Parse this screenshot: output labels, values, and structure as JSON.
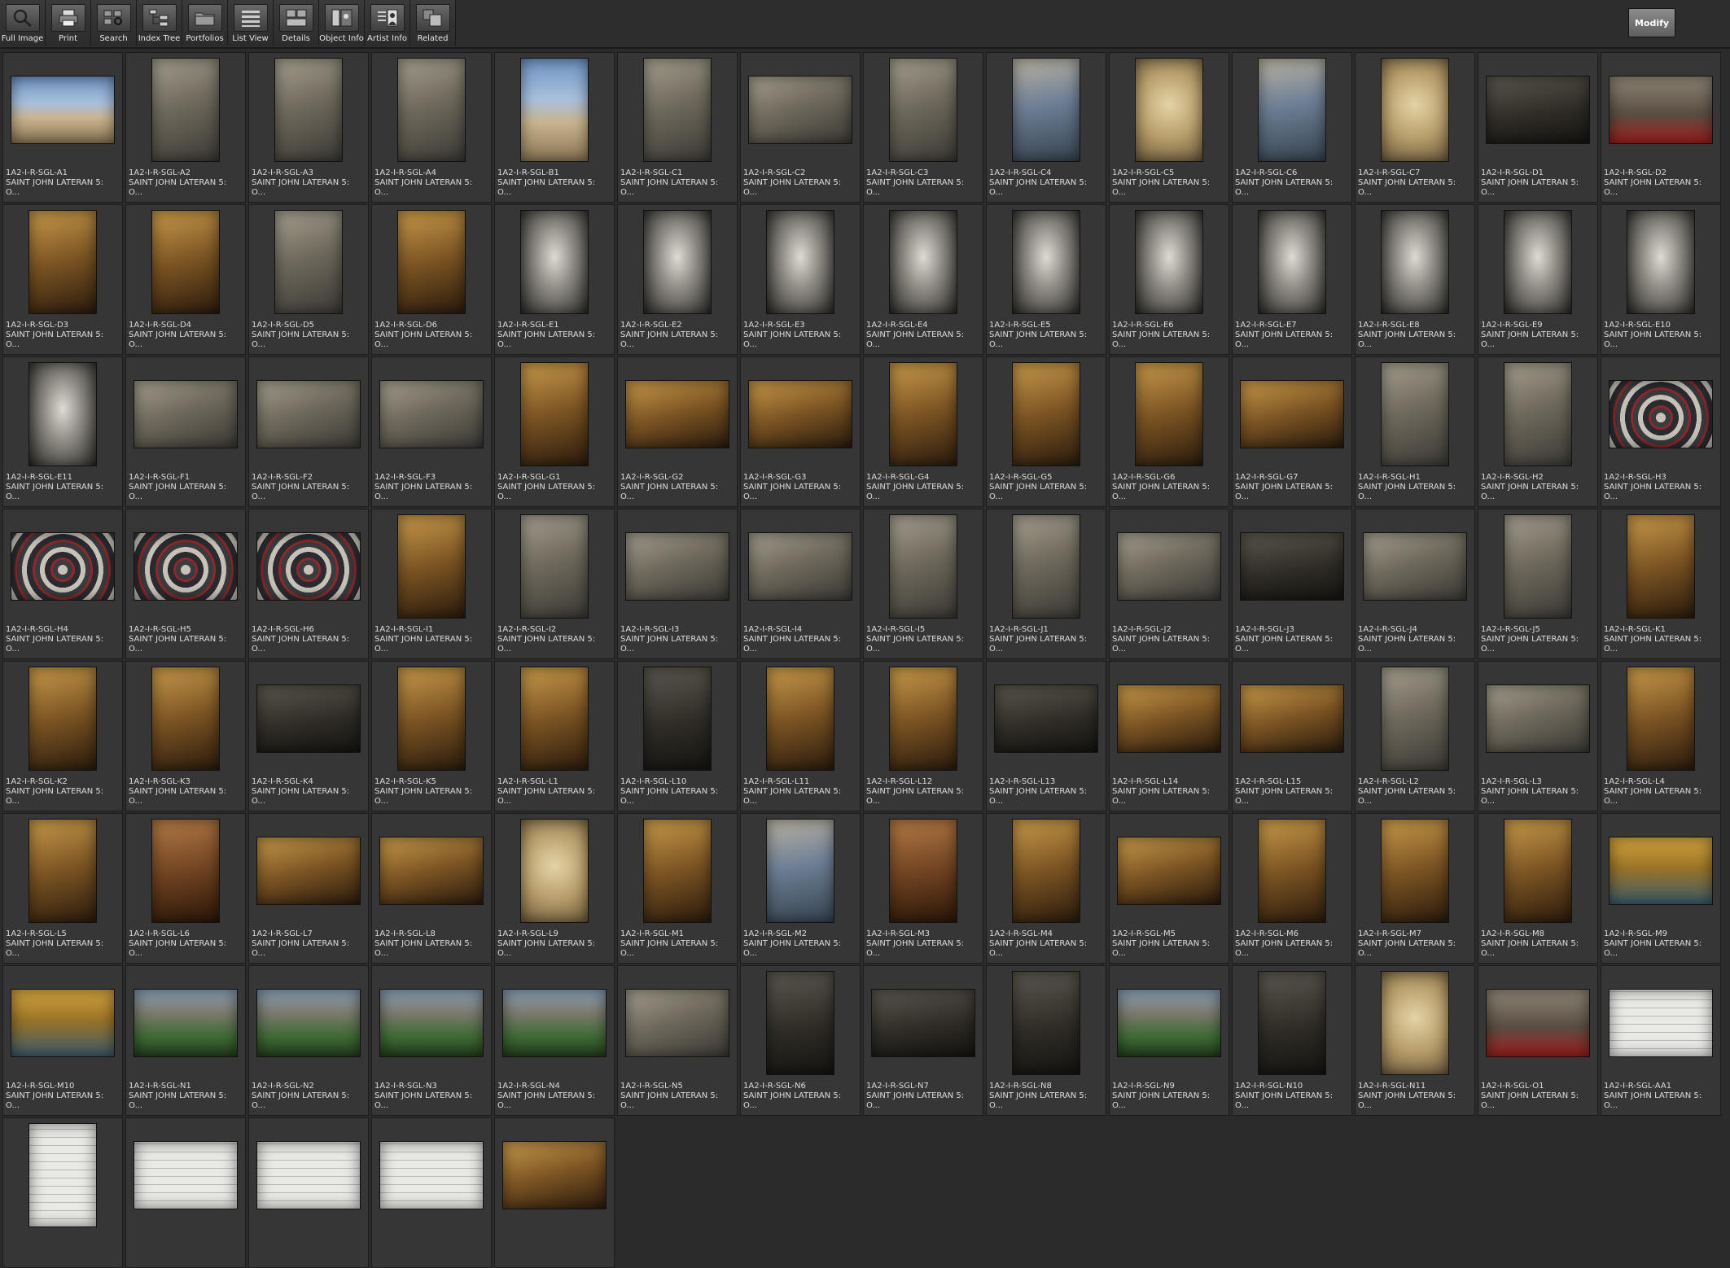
{
  "toolbar": {
    "buttons": [
      {
        "label": "Full Image",
        "icon": "magnifier-icon"
      },
      {
        "label": "Print",
        "icon": "printer-icon"
      },
      {
        "label": "Search",
        "icon": "search-icon"
      },
      {
        "label": "Index Tree",
        "icon": "index-tree-icon"
      },
      {
        "label": "Portfolios",
        "icon": "folder-icon"
      },
      {
        "label": "List View",
        "icon": "list-icon"
      },
      {
        "label": "Details",
        "icon": "details-icon"
      },
      {
        "label": "Object Info",
        "icon": "object-info-icon"
      },
      {
        "label": "Artist  Info",
        "icon": "artist-info-icon"
      },
      {
        "label": "Related",
        "icon": "related-icon"
      }
    ],
    "modify_label": "Modify"
  },
  "grid": {
    "title_text": "SAINT JOHN LATERAN 5:",
    "subtitle_text": "O...",
    "items": [
      {
        "code": "1A2-I-R-SGL-A1",
        "orient": "landscape",
        "tone": "sky"
      },
      {
        "code": "1A2-I-R-SGL-A2",
        "orient": "portrait",
        "tone": "stone"
      },
      {
        "code": "1A2-I-R-SGL-A3",
        "orient": "portrait",
        "tone": "stone"
      },
      {
        "code": "1A2-I-R-SGL-A4",
        "orient": "portrait",
        "tone": "stone"
      },
      {
        "code": "1A2-I-R-SGL-B1",
        "orient": "portrait",
        "tone": "sky"
      },
      {
        "code": "1A2-I-R-SGL-C1",
        "orient": "portrait",
        "tone": "stone"
      },
      {
        "code": "1A2-I-R-SGL-C2",
        "orient": "landscape",
        "tone": "stone"
      },
      {
        "code": "1A2-I-R-SGL-C3",
        "orient": "portrait",
        "tone": "stone"
      },
      {
        "code": "1A2-I-R-SGL-C4",
        "orient": "portrait",
        "tone": "blue"
      },
      {
        "code": "1A2-I-R-SGL-C5",
        "orient": "portrait",
        "tone": "fresco"
      },
      {
        "code": "1A2-I-R-SGL-C6",
        "orient": "portrait",
        "tone": "blue"
      },
      {
        "code": "1A2-I-R-SGL-C7",
        "orient": "portrait",
        "tone": "fresco"
      },
      {
        "code": "1A2-I-R-SGL-D1",
        "orient": "landscape",
        "tone": "dark"
      },
      {
        "code": "1A2-I-R-SGL-D2",
        "orient": "landscape",
        "tone": "red"
      },
      {
        "code": "1A2-I-R-SGL-D3",
        "orient": "portrait",
        "tone": "gold"
      },
      {
        "code": "1A2-I-R-SGL-D4",
        "orient": "portrait",
        "tone": "gold"
      },
      {
        "code": "1A2-I-R-SGL-D5",
        "orient": "portrait",
        "tone": "stone"
      },
      {
        "code": "1A2-I-R-SGL-D6",
        "orient": "portrait",
        "tone": "gold"
      },
      {
        "code": "1A2-I-R-SGL-E1",
        "orient": "portrait",
        "tone": "statue"
      },
      {
        "code": "1A2-I-R-SGL-E2",
        "orient": "portrait",
        "tone": "statue"
      },
      {
        "code": "1A2-I-R-SGL-E3",
        "orient": "portrait",
        "tone": "statue"
      },
      {
        "code": "1A2-I-R-SGL-E4",
        "orient": "portrait",
        "tone": "statue"
      },
      {
        "code": "1A2-I-R-SGL-E5",
        "orient": "portrait",
        "tone": "statue"
      },
      {
        "code": "1A2-I-R-SGL-E6",
        "orient": "portrait",
        "tone": "statue"
      },
      {
        "code": "1A2-I-R-SGL-E7",
        "orient": "portrait",
        "tone": "statue"
      },
      {
        "code": "1A2-I-R-SGL-E8",
        "orient": "portrait",
        "tone": "statue"
      },
      {
        "code": "1A2-I-R-SGL-E9",
        "orient": "portrait",
        "tone": "statue"
      },
      {
        "code": "1A2-I-R-SGL-E10",
        "orient": "portrait",
        "tone": "statue"
      },
      {
        "code": "1A2-I-R-SGL-E11",
        "orient": "portrait",
        "tone": "statue"
      },
      {
        "code": "1A2-I-R-SGL-F1",
        "orient": "landscape",
        "tone": "stone"
      },
      {
        "code": "1A2-I-R-SGL-F2",
        "orient": "landscape",
        "tone": "stone"
      },
      {
        "code": "1A2-I-R-SGL-F3",
        "orient": "landscape",
        "tone": "stone"
      },
      {
        "code": "1A2-I-R-SGL-G1",
        "orient": "portrait",
        "tone": "gold"
      },
      {
        "code": "1A2-I-R-SGL-G2",
        "orient": "landscape",
        "tone": "gold"
      },
      {
        "code": "1A2-I-R-SGL-G3",
        "orient": "landscape",
        "tone": "gold"
      },
      {
        "code": "1A2-I-R-SGL-G4",
        "orient": "portrait",
        "tone": "gold"
      },
      {
        "code": "1A2-I-R-SGL-G5",
        "orient": "portrait",
        "tone": "gold"
      },
      {
        "code": "1A2-I-R-SGL-G6",
        "orient": "portrait",
        "tone": "gold"
      },
      {
        "code": "1A2-I-R-SGL-G7",
        "orient": "landscape",
        "tone": "gold"
      },
      {
        "code": "1A2-I-R-SGL-H1",
        "orient": "portrait",
        "tone": "stone"
      },
      {
        "code": "1A2-I-R-SGL-H2",
        "orient": "portrait",
        "tone": "stone"
      },
      {
        "code": "1A2-I-R-SGL-H3",
        "orient": "landscape",
        "tone": "floor"
      },
      {
        "code": "1A2-I-R-SGL-H4",
        "orient": "landscape",
        "tone": "floor"
      },
      {
        "code": "1A2-I-R-SGL-H5",
        "orient": "landscape",
        "tone": "floor"
      },
      {
        "code": "1A2-I-R-SGL-H6",
        "orient": "landscape",
        "tone": "floor"
      },
      {
        "code": "1A2-I-R-SGL-I1",
        "orient": "portrait",
        "tone": "gold"
      },
      {
        "code": "1A2-I-R-SGL-I2",
        "orient": "portrait",
        "tone": "stone"
      },
      {
        "code": "1A2-I-R-SGL-I3",
        "orient": "landscape",
        "tone": "stone"
      },
      {
        "code": "1A2-I-R-SGL-I4",
        "orient": "landscape",
        "tone": "stone"
      },
      {
        "code": "1A2-I-R-SGL-I5",
        "orient": "portrait",
        "tone": "stone"
      },
      {
        "code": "1A2-I-R-SGL-J1",
        "orient": "portrait",
        "tone": "stone"
      },
      {
        "code": "1A2-I-R-SGL-J2",
        "orient": "landscape",
        "tone": "stone"
      },
      {
        "code": "1A2-I-R-SGL-J3",
        "orient": "landscape",
        "tone": "dark"
      },
      {
        "code": "1A2-I-R-SGL-J4",
        "orient": "landscape",
        "tone": "stone"
      },
      {
        "code": "1A2-I-R-SGL-J5",
        "orient": "portrait",
        "tone": "stone"
      },
      {
        "code": "1A2-I-R-SGL-K1",
        "orient": "portrait",
        "tone": "gold"
      },
      {
        "code": "1A2-I-R-SGL-K2",
        "orient": "portrait",
        "tone": "gold"
      },
      {
        "code": "1A2-I-R-SGL-K3",
        "orient": "portrait",
        "tone": "gold"
      },
      {
        "code": "1A2-I-R-SGL-K4",
        "orient": "landscape",
        "tone": "dark"
      },
      {
        "code": "1A2-I-R-SGL-K5",
        "orient": "portrait",
        "tone": "gold"
      },
      {
        "code": "1A2-I-R-SGL-L1",
        "orient": "portrait",
        "tone": "gold"
      },
      {
        "code": "1A2-I-R-SGL-L10",
        "orient": "portrait",
        "tone": "dark"
      },
      {
        "code": "1A2-I-R-SGL-L11",
        "orient": "portrait",
        "tone": "gold"
      },
      {
        "code": "1A2-I-R-SGL-L12",
        "orient": "portrait",
        "tone": "gold"
      },
      {
        "code": "1A2-I-R-SGL-L13",
        "orient": "landscape",
        "tone": "dark"
      },
      {
        "code": "1A2-I-R-SGL-L14",
        "orient": "landscape",
        "tone": "gold"
      },
      {
        "code": "1A2-I-R-SGL-L15",
        "orient": "landscape",
        "tone": "gold"
      },
      {
        "code": "1A2-I-R-SGL-L2",
        "orient": "portrait",
        "tone": "stone"
      },
      {
        "code": "1A2-I-R-SGL-L3",
        "orient": "landscape",
        "tone": "stone"
      },
      {
        "code": "1A2-I-R-SGL-L4",
        "orient": "portrait",
        "tone": "gold"
      },
      {
        "code": "1A2-I-R-SGL-L5",
        "orient": "portrait",
        "tone": "gold"
      },
      {
        "code": "1A2-I-R-SGL-L6",
        "orient": "portrait",
        "tone": "wood"
      },
      {
        "code": "1A2-I-R-SGL-L7",
        "orient": "landscape",
        "tone": "gold"
      },
      {
        "code": "1A2-I-R-SGL-L8",
        "orient": "landscape",
        "tone": "gold"
      },
      {
        "code": "1A2-I-R-SGL-L9",
        "orient": "portrait",
        "tone": "fresco"
      },
      {
        "code": "1A2-I-R-SGL-M1",
        "orient": "portrait",
        "tone": "gold"
      },
      {
        "code": "1A2-I-R-SGL-M2",
        "orient": "portrait",
        "tone": "blue"
      },
      {
        "code": "1A2-I-R-SGL-M3",
        "orient": "portrait",
        "tone": "wood"
      },
      {
        "code": "1A2-I-R-SGL-M4",
        "orient": "portrait",
        "tone": "gold"
      },
      {
        "code": "1A2-I-R-SGL-M5",
        "orient": "landscape",
        "tone": "gold"
      },
      {
        "code": "1A2-I-R-SGL-M6",
        "orient": "portrait",
        "tone": "gold"
      },
      {
        "code": "1A2-I-R-SGL-M7",
        "orient": "portrait",
        "tone": "gold"
      },
      {
        "code": "1A2-I-R-SGL-M8",
        "orient": "portrait",
        "tone": "gold"
      },
      {
        "code": "1A2-I-R-SGL-M9",
        "orient": "landscape",
        "tone": "mosaic"
      },
      {
        "code": "1A2-I-R-SGL-M10",
        "orient": "landscape",
        "tone": "mosaic"
      },
      {
        "code": "1A2-I-R-SGL-N1",
        "orient": "landscape",
        "tone": "green"
      },
      {
        "code": "1A2-I-R-SGL-N2",
        "orient": "landscape",
        "tone": "green"
      },
      {
        "code": "1A2-I-R-SGL-N3",
        "orient": "landscape",
        "tone": "green"
      },
      {
        "code": "1A2-I-R-SGL-N4",
        "orient": "landscape",
        "tone": "green"
      },
      {
        "code": "1A2-I-R-SGL-N5",
        "orient": "landscape",
        "tone": "stone"
      },
      {
        "code": "1A2-I-R-SGL-N6",
        "orient": "portrait",
        "tone": "dark"
      },
      {
        "code": "1A2-I-R-SGL-N7",
        "orient": "landscape",
        "tone": "dark"
      },
      {
        "code": "1A2-I-R-SGL-N8",
        "orient": "portrait",
        "tone": "dark"
      },
      {
        "code": "1A2-I-R-SGL-N9",
        "orient": "landscape",
        "tone": "green"
      },
      {
        "code": "1A2-I-R-SGL-N10",
        "orient": "portrait",
        "tone": "dark"
      },
      {
        "code": "1A2-I-R-SGL-N11",
        "orient": "portrait",
        "tone": "fresco"
      },
      {
        "code": "1A2-I-R-SGL-O1",
        "orient": "landscape",
        "tone": "red"
      },
      {
        "code": "1A2-I-R-SGL-AA1",
        "orient": "landscape",
        "tone": "plan"
      },
      {
        "code": "",
        "orient": "portrait",
        "tone": "plan"
      },
      {
        "code": "",
        "orient": "landscape",
        "tone": "plan"
      },
      {
        "code": "",
        "orient": "landscape",
        "tone": "plan"
      },
      {
        "code": "",
        "orient": "landscape",
        "tone": "plan"
      },
      {
        "code": "",
        "orient": "landscape",
        "tone": "gold"
      }
    ]
  },
  "tones": {
    "sky": "linear-gradient(180deg,#6f94c4 0%,#a9c0dc 40%,#c9b48e 62%,#8b7656 100%)",
    "stone": "linear-gradient(160deg,#a6a08f 0%,#6f6a5d 45%,#3c3a35 100%)",
    "blue": "linear-gradient(170deg,#b9b3a2 0%,#6e7f96 45%,#36434f 100%)",
    "fresco": "radial-gradient(circle at 50% 45%,#e4d3a6 0%,#b89f6c 50%,#6e5c3e 100%)",
    "dark": "linear-gradient(170deg,#5c584e 0%,#2f2c26 55%,#151412 100%)",
    "red": "linear-gradient(180deg,#8f8778 0%,#5a4e42 55%,#9c1f1f 100%)",
    "gold": "linear-gradient(165deg,#c99a4a 0%,#7a5323 50%,#2b1c0d 100%)",
    "statue": "radial-gradient(ellipse at 50% 45%,#dedbd3 0%,#8f8c85 40%,#2a2926 100%)",
    "floor": "repeating-radial-gradient(circle at 50% 55%,#c6c2b8 0 6px,#3b3a3f 6px 12px,#8a2a2a 12px 15px,#2a2a30 15px 22px)",
    "wood": "linear-gradient(170deg,#b57a45 0%,#6b3f1f 55%,#2a1709 100%)",
    "mosaic": "linear-gradient(180deg,#d6a640 0%,#9a7427 45%,#3d5a6b 100%)",
    "green": "linear-gradient(180deg,#8aa0b8 0%,#7c7a6d 35%,#3f6a35 70%,#24401d 100%)",
    "plan": "repeating-linear-gradient(0deg,#e9e9e6 0 9px,#b9b9b4 9px 10px),linear-gradient(#eeeeea,#eeeeea)"
  }
}
